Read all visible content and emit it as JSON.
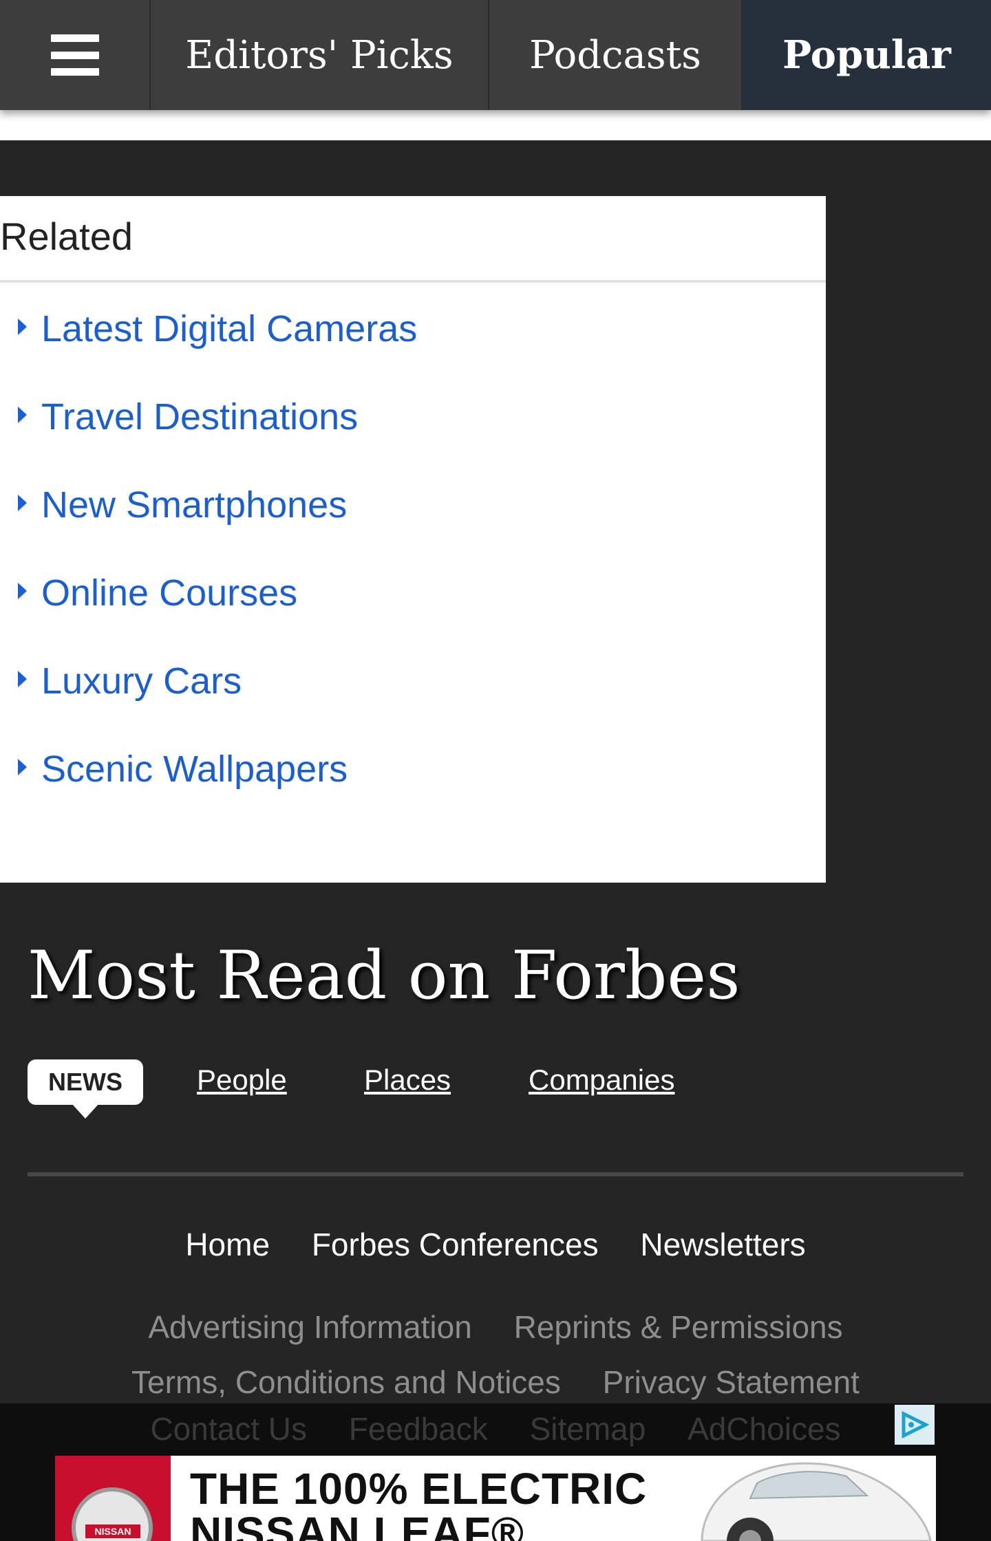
{
  "topnav": {
    "menu_icon": "hamburger-icon",
    "tabs": [
      {
        "label": "Editors' Picks"
      },
      {
        "label": "Podcasts"
      },
      {
        "label": "Popular",
        "active": true
      }
    ]
  },
  "related": {
    "title": "Related",
    "items": [
      {
        "label": "Latest Digital Cameras"
      },
      {
        "label": "Travel Destinations"
      },
      {
        "label": "New Smartphones"
      },
      {
        "label": "Online Courses"
      },
      {
        "label": "Luxury Cars"
      },
      {
        "label": "Scenic Wallpapers"
      }
    ]
  },
  "most_read": {
    "title": "Most Read on Forbes",
    "tabs": [
      {
        "label": "NEWS",
        "active": true
      },
      {
        "label": "People"
      },
      {
        "label": "Places"
      },
      {
        "label": "Companies"
      }
    ]
  },
  "footer": {
    "primary": [
      "Home",
      "Forbes Conferences",
      "Newsletters"
    ],
    "secondary_row1": [
      "Advertising Information",
      "Reprints & Permissions"
    ],
    "secondary_row2": [
      "Terms, Conditions and Notices",
      "Privacy Statement"
    ],
    "secondary_row3": [
      "Contact Us",
      "Feedback",
      "Sitemap",
      "AdChoices"
    ]
  },
  "ad": {
    "brand": "NISSAN",
    "headline_line1": "THE 100% ELECTRIC",
    "headline_line2": "NISSAN LEAF®",
    "adchoices_icon": "adchoices-icon"
  },
  "colors": {
    "link_blue": "#1b5ed0",
    "page_bg": "#252525",
    "nav_bg": "#3d3d3d",
    "active_tab_bg": "#26303c",
    "nissan_red": "#c8102e"
  }
}
